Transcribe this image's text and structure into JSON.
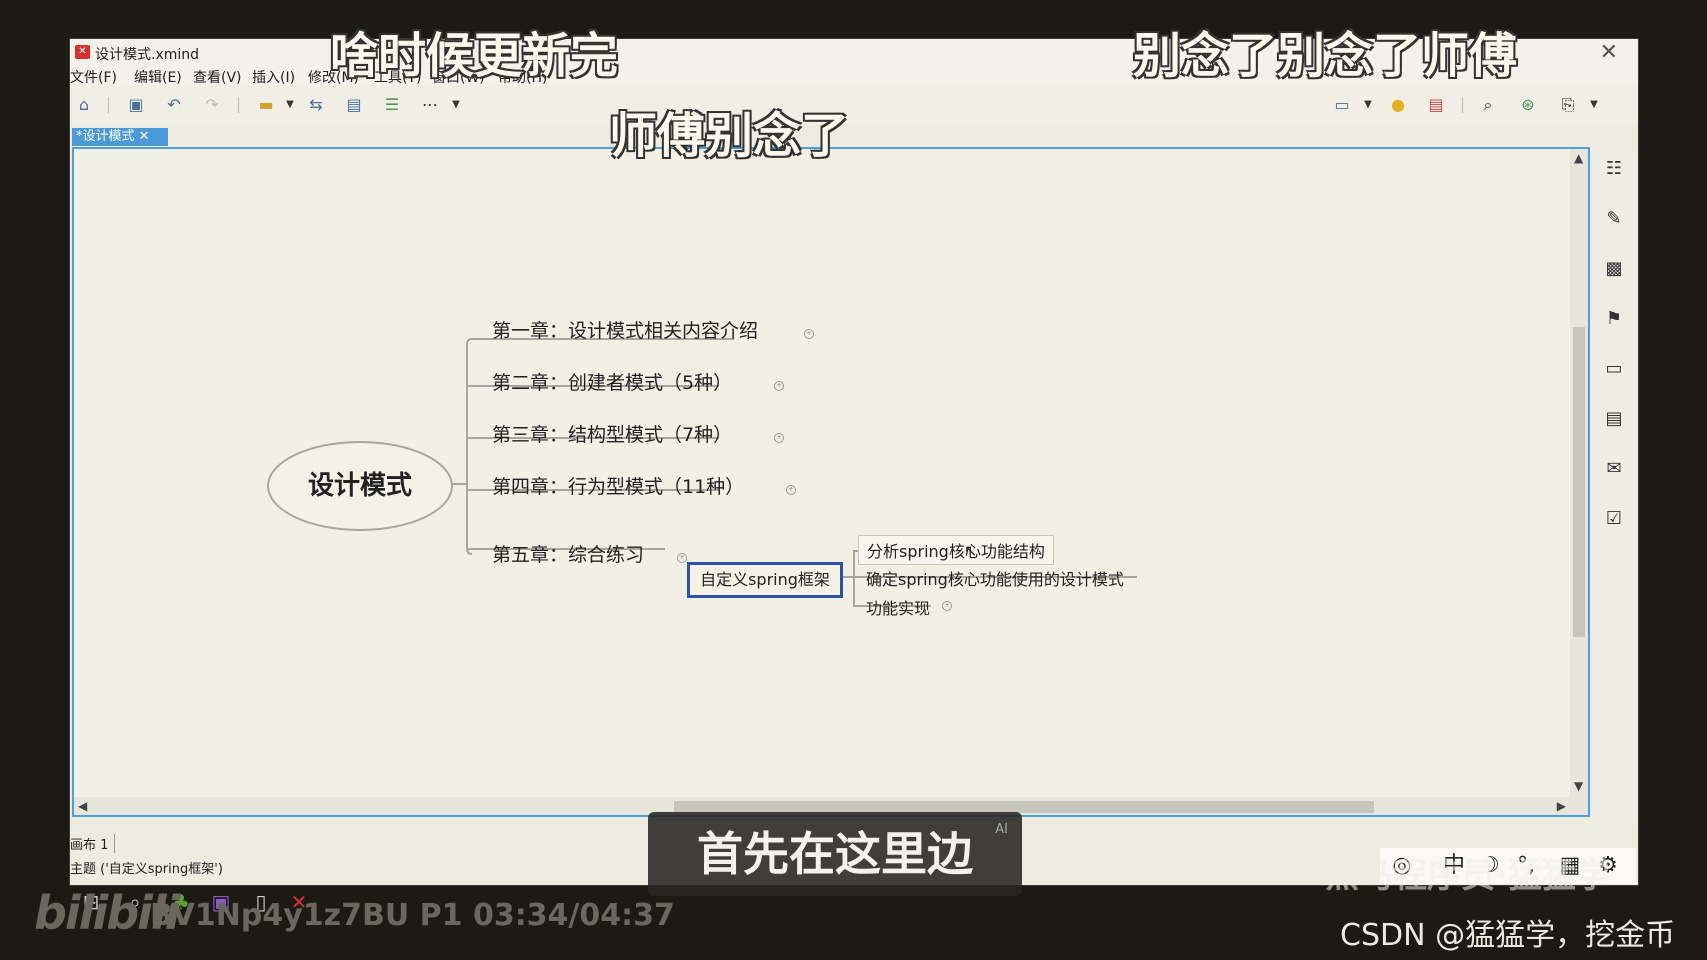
{
  "window": {
    "title": "设计模式.xmind",
    "app_icon": "xmind-icon",
    "close_glyph": "✕"
  },
  "menu": [
    "文件(F)",
    "编辑(E)",
    "查看(V)",
    "插入(I)",
    "修改(M)",
    "工具(T)",
    "窗口(W)",
    "帮助(H)"
  ],
  "tab": {
    "label": "*设计模式 ✕"
  },
  "mindmap": {
    "root": "设计模式",
    "chapters": [
      "第一章：设计模式相关内容介绍",
      "第二章：创建者模式（5种）",
      "第三章：结构型模式（7种）",
      "第四章：行为型模式（11种）",
      "第五章：综合练习"
    ],
    "selected_topic": "自定义spring框架",
    "subtopics": [
      "分析spring核心功能结构",
      "确定spring核心功能使用的设计模式",
      "功能实现"
    ]
  },
  "status": {
    "sheet": "画布 1",
    "topic": "主题 ('自定义spring框架')"
  },
  "overlay": {
    "danmaku": [
      "啥时候更新完",
      "别念了别念了师傅",
      "师傅别念了"
    ],
    "subtitle": "首先在这里边",
    "ai_tag": "AI",
    "bilibili_logo": "bilibili",
    "video_info": "BV1Np4y1z7BU P1 03:34/04:37",
    "watermark": "CSDN @猛猛学，挖金币",
    "faded_watermark": "黑马程序员·猛猛学"
  },
  "colors": {
    "selection": "#3050a8",
    "canvas_border": "#4aa0d8",
    "tab_active": "#4a9ad8"
  }
}
